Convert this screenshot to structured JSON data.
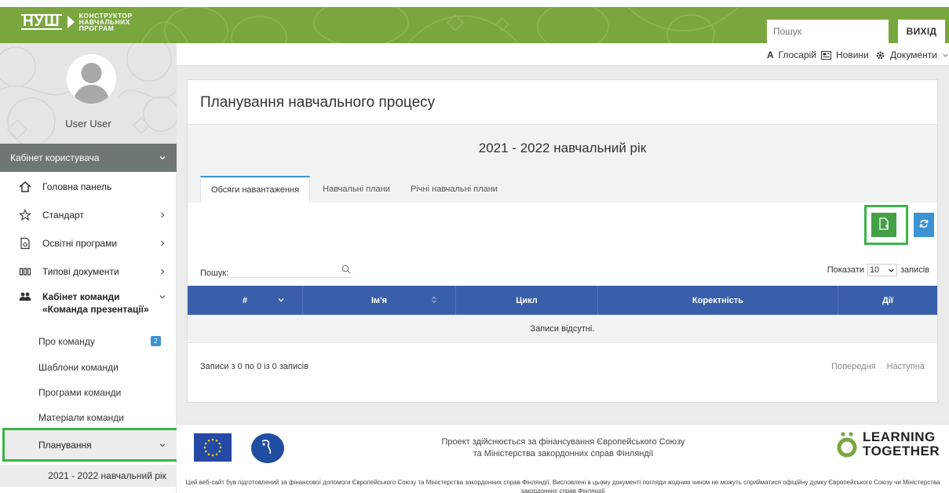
{
  "header": {
    "logo_mark": "НУШ",
    "logo_lines": [
      "КОНСТРУКТОР",
      "НАВЧАЛЬНИХ",
      "ПРОГРАМ"
    ],
    "search_placeholder": "Пошук",
    "exit_label": "ВИХІД",
    "accent_color": "#7aa63f"
  },
  "sidebar": {
    "user_name": "User User",
    "cabinet_label": "Кабінет користувача",
    "nav": [
      {
        "label": "Головна панель",
        "icon": "home-icon"
      },
      {
        "label": "Стандарт",
        "icon": "star-icon"
      },
      {
        "label": "Освітні програми",
        "icon": "document-icon"
      },
      {
        "label": "Типові документи",
        "icon": "books-icon"
      },
      {
        "label": "Кабінет команди «Команда презентації»",
        "icon": "team-icon"
      }
    ],
    "team_sub": [
      {
        "label": "Про команду",
        "badge": "2"
      },
      {
        "label": "Шаблони команди"
      },
      {
        "label": "Програми команди"
      },
      {
        "label": "Матеріали команди"
      }
    ],
    "planning_label": "Планування",
    "planning_sub": "2021 - 2022 навчальний рік"
  },
  "toplinks": {
    "glossary": "Глосарій",
    "news": "Новини",
    "documents": "Документи"
  },
  "main": {
    "title": "Планування навчального процесу",
    "year_title": "2021 - 2022 навчальний рік",
    "tabs": [
      "Обсяги навантаження",
      "Навчальні плани",
      "Річні навчальні плани"
    ],
    "search_label": "Пошук:",
    "show_prefix": "Показати",
    "show_value": "10",
    "show_suffix": "записів",
    "columns": [
      "#",
      "Ім'я",
      "Цикл",
      "Коректність",
      "Дії"
    ],
    "empty_text": "Записи відсутні.",
    "info": "Записи з 0 по 0 із 0 записів",
    "prev": "Попередня",
    "next": "Наступна",
    "table_header_color": "#3a5faa",
    "add_button_color": "#43a047",
    "refresh_button_color": "#3b93d4"
  },
  "footer": {
    "project_line1": "Проект здійснюється за фінансування Європейського Союзу",
    "project_line2": "та Міністерства закордонних справ Фінляндії",
    "lt_line1": "LEARNING",
    "lt_line2": "TOGETHER",
    "disclaimer": "Цей веб-сайт був підготовлений за фінансової допомоги Європейського Союзу та Міністерства закордонних справ Фінляндії. Висловлені в цьому документі погляди жодним чином не можуть сприйматися офіційну думку Європейського Союзу чи Міністерства закордонних справ Фінляндії"
  }
}
